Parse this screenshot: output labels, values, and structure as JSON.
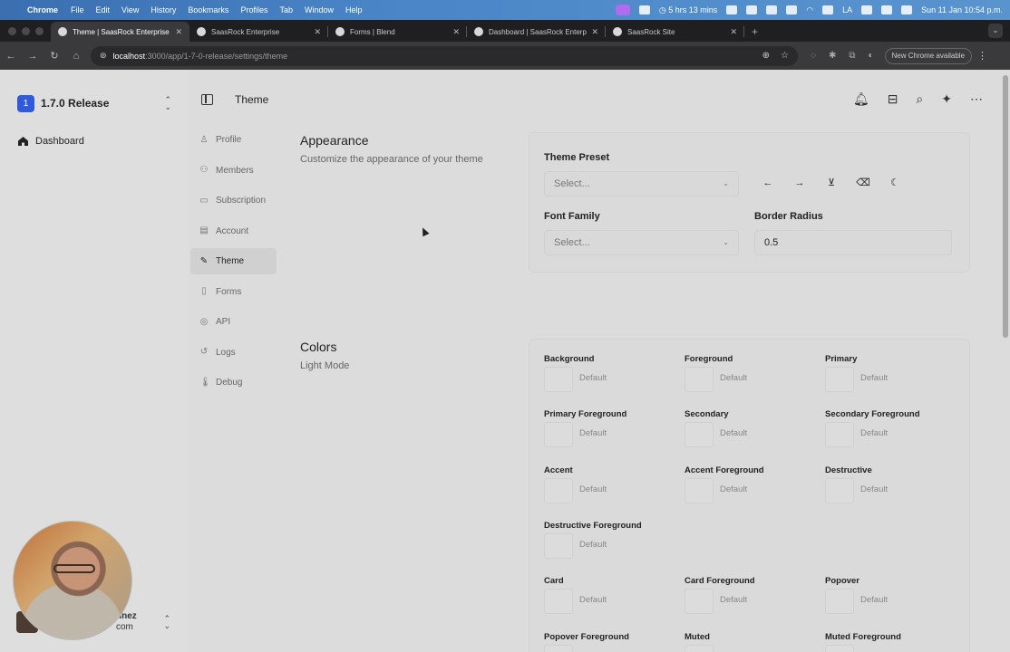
{
  "menubar": {
    "app": "Chrome",
    "items": [
      "File",
      "Edit",
      "View",
      "History",
      "Bookmarks",
      "Profiles",
      "Tab",
      "Window",
      "Help"
    ],
    "battery_time": "5 hrs 13 mins",
    "input_source": "LA",
    "datetime": "Sun 11 Jan  10:54 p.m."
  },
  "tabs": [
    {
      "title": "Theme | SaasRock Enterprise"
    },
    {
      "title": "SaasRock Enterprise"
    },
    {
      "title": "Forms | Blend"
    },
    {
      "title": "Dashboard | SaasRock Enterp"
    },
    {
      "title": "SaasRock Site"
    }
  ],
  "addressbar": {
    "host": "localhost",
    "path": ":3000/app/1-7-0-release/settings/theme",
    "new_chrome": "New Chrome available"
  },
  "sidebar": {
    "workspace_badge": "1",
    "workspace_name": "1.7.0 Release",
    "dashboard": "Dashboard",
    "user_name": "tínez",
    "user_email": "com"
  },
  "header": {
    "title": "Theme"
  },
  "settings_nav": [
    "Profile",
    "Members",
    "Subscription",
    "Account",
    "Theme",
    "Forms",
    "API",
    "Logs",
    "Debug"
  ],
  "appearance": {
    "title": "Appearance",
    "description": "Customize the appearance of your theme",
    "theme_preset_label": "Theme Preset",
    "theme_preset_placeholder": "Select...",
    "font_family_label": "Font Family",
    "font_family_placeholder": "Select...",
    "border_radius_label": "Border Radius",
    "border_radius_value": "0.5"
  },
  "colors": {
    "title": "Colors",
    "description": "Light Mode",
    "default_text": "Default",
    "items": [
      "Background",
      "Foreground",
      "Primary",
      "Primary Foreground",
      "Secondary",
      "Secondary Foreground",
      "Accent",
      "Accent Foreground",
      "Destructive",
      "Destructive Foreground",
      "",
      "",
      "Card",
      "Card Foreground",
      "Popover",
      "Popover Foreground",
      "Muted",
      "Muted Foreground"
    ]
  }
}
